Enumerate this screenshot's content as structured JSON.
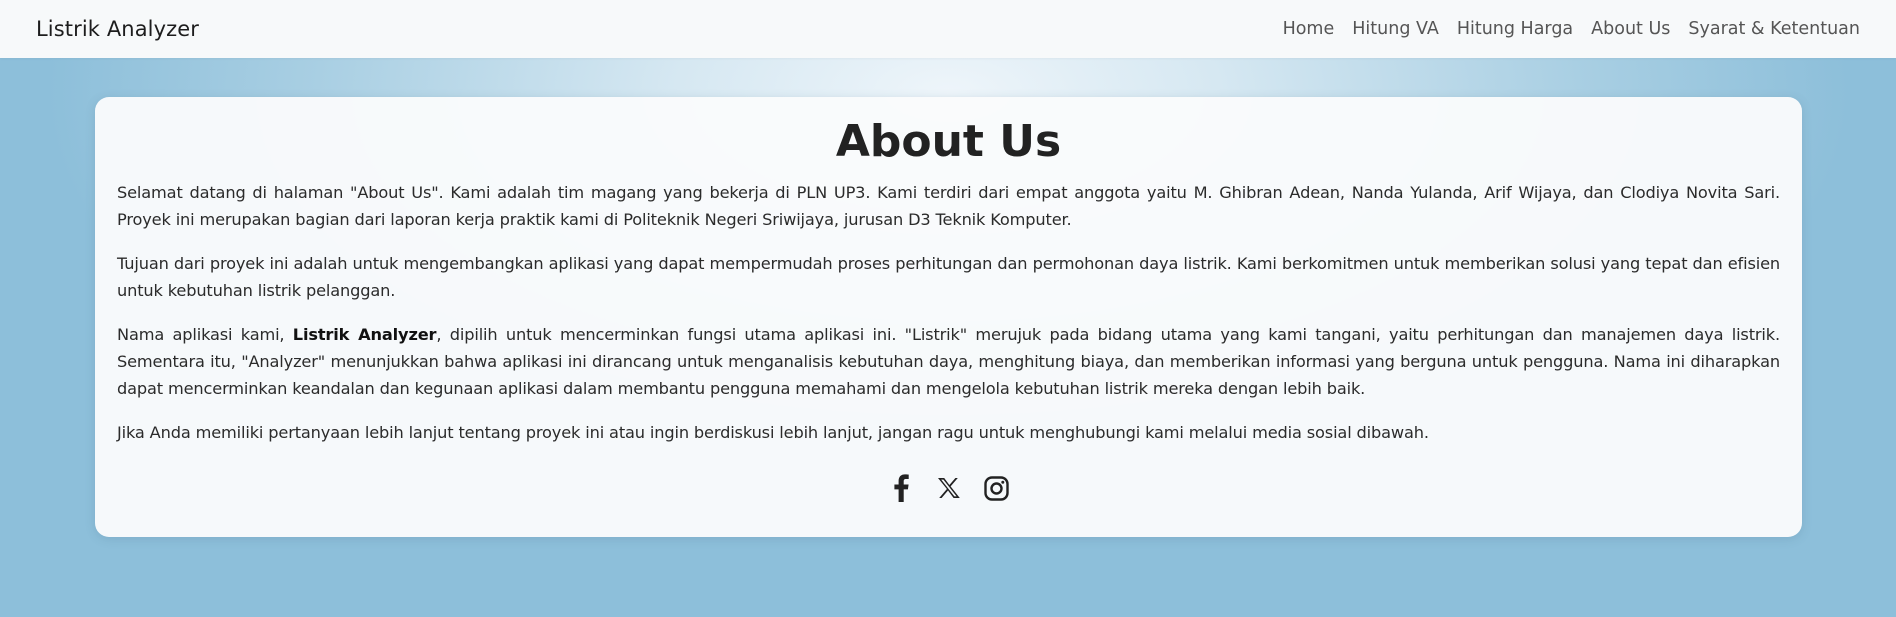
{
  "navbar": {
    "brand": "Listrik Analyzer",
    "links": [
      "Home",
      "Hitung VA",
      "Hitung Harga",
      "About Us",
      "Syarat & Ketentuan"
    ]
  },
  "main": {
    "title": "About Us",
    "paragraphs": {
      "p1": "Selamat datang di halaman \"About Us\". Kami adalah tim magang yang bekerja di PLN UP3. Kami terdiri dari empat anggota yaitu M. Ghibran Adean, Nanda Yulanda, Arif Wijaya, dan Clodiya Novita Sari. Proyek ini merupakan bagian dari laporan kerja praktik kami di Politeknik Negeri Sriwijaya, jurusan D3 Teknik Komputer.",
      "p2": "Tujuan dari proyek ini adalah untuk mengembangkan aplikasi yang dapat mempermudah proses perhitungan dan permohonan daya listrik. Kami berkomitmen untuk memberikan solusi yang tepat dan efisien untuk kebutuhan listrik pelanggan.",
      "p3_before": "Nama aplikasi kami, ",
      "p3_bold": "Listrik Analyzer",
      "p3_after": ", dipilih untuk mencerminkan fungsi utama aplikasi ini. \"Listrik\" merujuk pada bidang utama yang kami tangani, yaitu perhitungan dan manajemen daya listrik. Sementara itu, \"Analyzer\" menunjukkan bahwa aplikasi ini dirancang untuk menganalisis kebutuhan daya, menghitung biaya, dan memberikan informasi yang berguna untuk pengguna. Nama ini diharapkan dapat mencerminkan keandalan dan kegunaan aplikasi dalam membantu pengguna memahami dan mengelola kebutuhan listrik mereka dengan lebih baik.",
      "p4": "Jika Anda memiliki pertanyaan lebih lanjut tentang proyek ini atau ingin berdiskusi lebih lanjut, jangan ragu untuk menghubungi kami melalui media sosial dibawah."
    },
    "social_icons": [
      "facebook-icon",
      "x-icon",
      "instagram-icon"
    ]
  },
  "colors": {
    "navbar_bg": "#f7f9fa",
    "page_bg": "#a9cfe3",
    "card_bg": "#fafbfc",
    "text": "#222222"
  }
}
